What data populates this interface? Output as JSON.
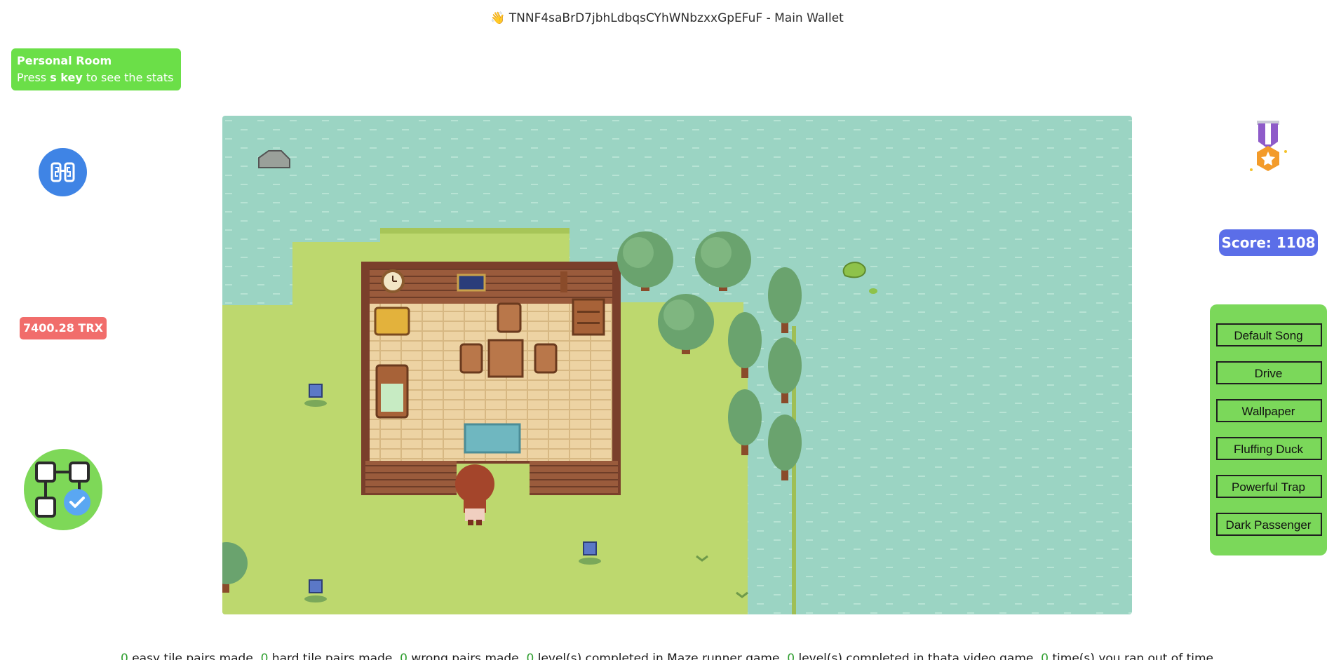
{
  "header": {
    "icon": "waving-hand-icon",
    "wave": "👋",
    "title": "TNNF4saBrD7jbhLdbqsCYhWNbzxxGpEFuF - Main Wallet"
  },
  "room_card": {
    "title": "Personal Room",
    "press": "Press",
    "key": "s key",
    "suffix": "to see the stats"
  },
  "left_sidebar": {
    "wallet_icon": "wallet-connect-icon",
    "balance": "7400.28 TRX",
    "workflow_icon": "workflow-check-icon"
  },
  "right_sidebar": {
    "medal_icon": "medal-icon",
    "score": "Score: 1108",
    "songs": [
      "Default Song",
      "Drive",
      "Wallpaper",
      "Fluffing Duck",
      "Powerful Trap",
      "Dark Passenger"
    ]
  },
  "stats": {
    "easy_pairs": "0",
    "easy_label": "easy tile pairs made,",
    "hard_pairs": "0",
    "hard_label": "hard tile pairs made,",
    "wrong_pairs": "0",
    "wrong_label": "wrong pairs made,",
    "maze_levels": "0",
    "maze_label": "level(s) completed in Maze runner game,",
    "thata_levels": "0",
    "thata_label": "level(s) completed in thata video game,",
    "timeouts": "0",
    "timeout_label": "time(s) you ran out of time"
  },
  "colors": {
    "water": "#9bd4c3",
    "grass": "#bdd86e",
    "room_card": "#6bdf48",
    "score_badge": "#5b6ee8",
    "balance_badge": "#f16d6b",
    "music_panel": "#7bd85a"
  }
}
